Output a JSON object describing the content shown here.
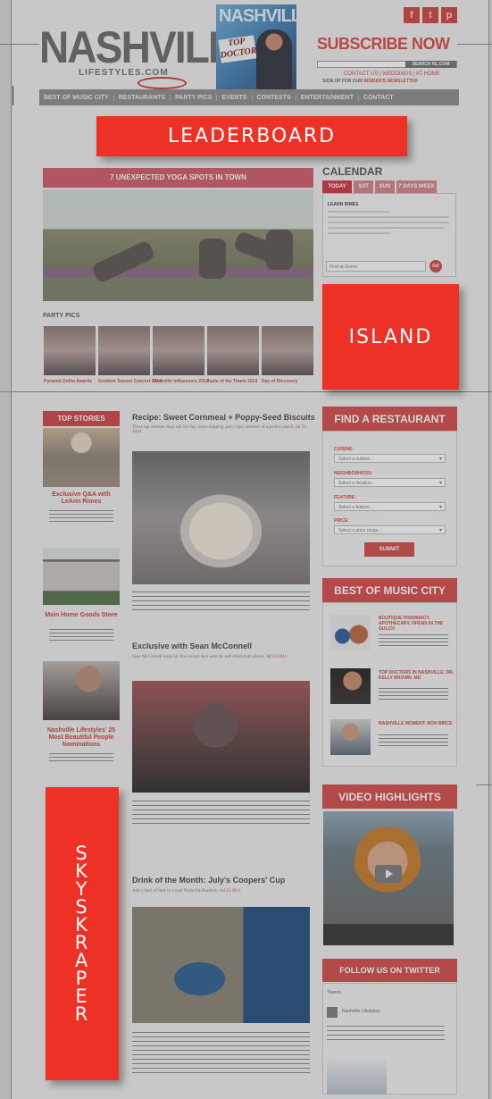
{
  "header": {
    "logo_text": "NASHVILLE",
    "logo_sub": "LIFESTYLES.COM",
    "cover_title": "NASHVILLE",
    "cover_banner": "TOP DOCTORS",
    "subscribe": "SUBSCRIBE NOW",
    "search_button": "SEARCH NL.COM",
    "util_links": "CONTACT US  |  WEDDINGS  |  AT HOME",
    "signup_text": "SIGN UP FOR OUR",
    "signup_link": "INSIDER'S NEWSLETTER"
  },
  "social": [
    "f",
    "t",
    "p"
  ],
  "nav": [
    "BEST OF MUSIC CITY",
    "RESTAURANTS",
    "PARTY PICS",
    "EVENTS",
    "CONTESTS",
    "ENTERTAINMENT",
    "CONTACT"
  ],
  "ads": {
    "leaderboard": "LEADERBOARD",
    "island": "ISLAND",
    "skyscraper_letters": [
      "S",
      "K",
      "Y",
      "S",
      "K",
      "R",
      "A",
      "P",
      "E",
      "R"
    ]
  },
  "hero": {
    "title": "7 UNEXPECTED YOGA SPOTS IN TOWN"
  },
  "party": {
    "title": "PARTY PICS",
    "items": [
      "Pyramid Detha Awards",
      "Gentlem Sunset Concert 2014",
      "Nashville Influencers 2014",
      "Taste of the Titans 2014",
      "Day of Discovery"
    ]
  },
  "calendar": {
    "title": "CALENDAR",
    "tabs": [
      "TODAY",
      "SAT",
      "SUN",
      "7 DAYS WEEK"
    ],
    "event": "LEANN RIMES",
    "search_placeholder": "Find an Event",
    "go": "GO"
  },
  "top_stories": {
    "title": "TOP STORIES",
    "items": [
      {
        "title": "Exclusive Q&A with LeAnn Rimes"
      },
      {
        "title": "Main Home Goods Store"
      },
      {
        "title": "Nashville Lifestyles' 25 Most Beautiful People Nominations"
      }
    ]
  },
  "articles": [
    {
      "title": "Recipe: Sweet Cornmeal + Poppy-Seed Biscuits",
      "meta_prefix": "These hot summer days call for this citrus-dripping, juicy tipsy summer of a perfect peach.",
      "date": "Jul 25 2014"
    },
    {
      "title": "Exclusive with Sean McConnell",
      "meta_prefix": "Sean McConnell leads his first record deal with his self-titled sixth album.",
      "date": "Jul 24 2014"
    },
    {
      "title": "Drink of the Month: July's Coopers' Cup",
      "meta_prefix": "Add a dash of lime to a cool Nashville Bourbon.",
      "date": "Jul 23 2014"
    }
  ],
  "restaurant": {
    "title": "FIND A RESTAURANT",
    "fields": [
      {
        "label": "CUISINE:",
        "value": "Select a cuisine..."
      },
      {
        "label": "NEIGHBORHOOD:",
        "value": "Select a location..."
      },
      {
        "label": "FEATURE:",
        "value": "Select a feature..."
      },
      {
        "label": "PRICE:",
        "value": "Select a price range..."
      }
    ],
    "submit": "SUBMIT"
  },
  "best_of": {
    "title": "BEST OF MUSIC CITY",
    "items": [
      {
        "title": "BOUTIQUE PHARMACY, APOTHECARY, OPENS IN THE GULCH"
      },
      {
        "title": "TOP DOCTORS IN NASHVILLE: DR. KELLY BROWN, MD"
      },
      {
        "title": "NASHVILLE MOMENT: RON BRICE"
      }
    ]
  },
  "video": {
    "title": "VIDEO HIGHLIGHTS"
  },
  "twitter": {
    "title": "FOLLOW US ON TWITTER",
    "tweets_label": "Tweets",
    "account": "Nashville Lifestyles"
  }
}
